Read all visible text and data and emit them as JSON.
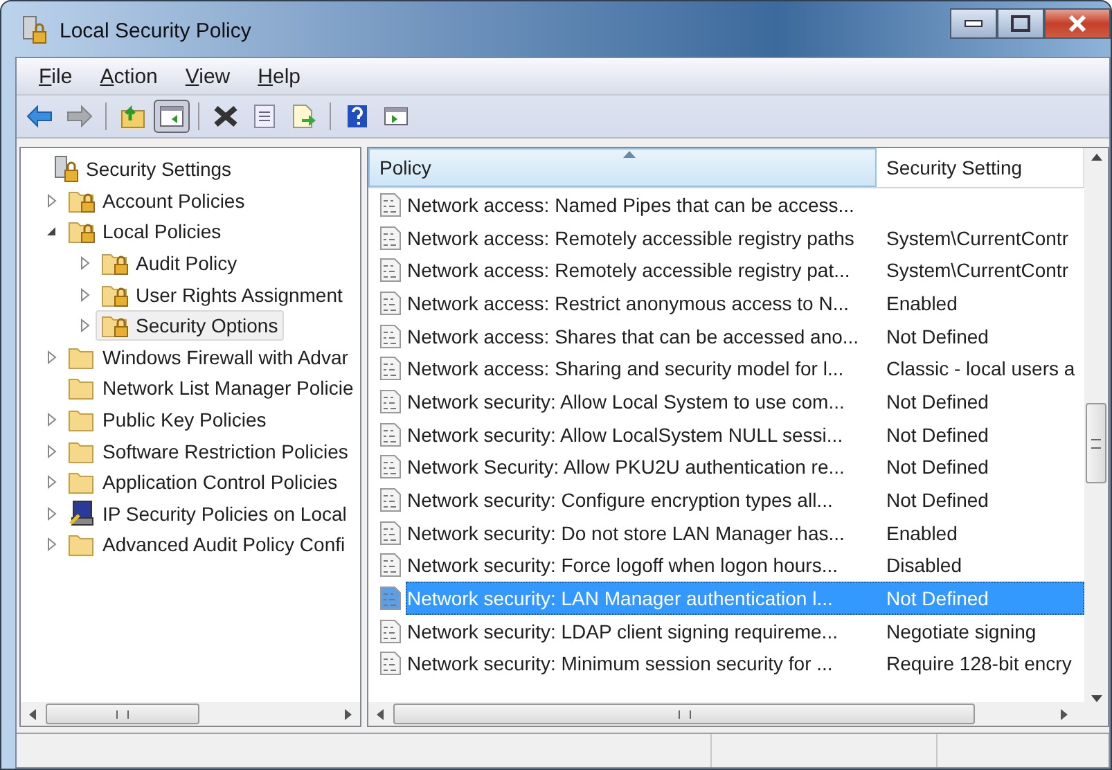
{
  "window": {
    "title": "Local Security Policy"
  },
  "menu": [
    "File",
    "Action",
    "View",
    "Help"
  ],
  "toolbar": [
    {
      "kind": "back",
      "disabled": false,
      "pressed": false
    },
    {
      "kind": "forward",
      "disabled": true,
      "pressed": false
    },
    {
      "kind": "sep"
    },
    {
      "kind": "up",
      "disabled": false,
      "pressed": false
    },
    {
      "kind": "tree",
      "disabled": false,
      "pressed": true
    },
    {
      "kind": "sep"
    },
    {
      "kind": "delete",
      "disabled": false,
      "pressed": false
    },
    {
      "kind": "properties",
      "disabled": false,
      "pressed": false
    },
    {
      "kind": "export",
      "disabled": false,
      "pressed": false
    },
    {
      "kind": "sep"
    },
    {
      "kind": "help",
      "disabled": false,
      "pressed": false
    },
    {
      "kind": "actionpane",
      "disabled": false,
      "pressed": false
    }
  ],
  "tree": [
    {
      "label": "Security Settings",
      "kind": "root",
      "selected": false,
      "children": [
        {
          "label": "Account Policies",
          "kind": "locked",
          "selected": false,
          "expanded": false
        },
        {
          "label": "Local Policies",
          "kind": "locked",
          "selected": false,
          "expanded": true,
          "children": [
            {
              "label": "Audit Policy",
              "kind": "locked",
              "selected": false,
              "expanded": false
            },
            {
              "label": "User Rights Assignment",
              "kind": "locked",
              "selected": false,
              "expanded": false
            },
            {
              "label": "Security Options",
              "kind": "locked",
              "selected": true,
              "expanded": false
            }
          ]
        },
        {
          "label": "Windows Firewall with Advar",
          "kind": "folder",
          "selected": false,
          "expanded": false
        },
        {
          "label": "Network List Manager Policie",
          "kind": "folder",
          "selected": false
        },
        {
          "label": "Public Key Policies",
          "kind": "folder",
          "selected": false,
          "expanded": false
        },
        {
          "label": "Software Restriction Policies",
          "kind": "folder",
          "selected": false,
          "expanded": false
        },
        {
          "label": "Application Control Policies",
          "kind": "folder",
          "selected": false,
          "expanded": false
        },
        {
          "label": "IP Security Policies on Local",
          "kind": "computer",
          "selected": false,
          "expanded": false
        },
        {
          "label": "Advanced Audit Policy Confi",
          "kind": "folder",
          "selected": false,
          "expanded": false
        }
      ]
    }
  ],
  "table": {
    "columns": [
      {
        "label": "Policy",
        "sorted": true
      },
      {
        "label": "Security Setting",
        "sorted": false
      }
    ],
    "rows": [
      {
        "policy": "Network access: Named Pipes that can be access...",
        "setting": "",
        "selected": false
      },
      {
        "policy": "Network access: Remotely accessible registry paths",
        "setting": "System\\CurrentContr",
        "selected": false
      },
      {
        "policy": "Network access: Remotely accessible registry pat...",
        "setting": "System\\CurrentContr",
        "selected": false
      },
      {
        "policy": "Network access: Restrict anonymous access to N...",
        "setting": "Enabled",
        "selected": false
      },
      {
        "policy": "Network access: Shares that can be accessed ano...",
        "setting": "Not Defined",
        "selected": false
      },
      {
        "policy": "Network access: Sharing and security model for l...",
        "setting": "Classic - local users a",
        "selected": false
      },
      {
        "policy": "Network security: Allow Local System to use com...",
        "setting": "Not Defined",
        "selected": false
      },
      {
        "policy": "Network security: Allow LocalSystem NULL sessi...",
        "setting": "Not Defined",
        "selected": false
      },
      {
        "policy": "Network Security: Allow PKU2U authentication re...",
        "setting": "Not Defined",
        "selected": false
      },
      {
        "policy": "Network security: Configure encryption types all...",
        "setting": "Not Defined",
        "selected": false
      },
      {
        "policy": "Network security: Do not store LAN Manager has...",
        "setting": "Enabled",
        "selected": false
      },
      {
        "policy": "Network security: Force logoff when logon hours...",
        "setting": "Disabled",
        "selected": false
      },
      {
        "policy": "Network security: LAN Manager authentication l...",
        "setting": "Not Defined",
        "selected": true
      },
      {
        "policy": "Network security: LDAP client signing requireme...",
        "setting": "Negotiate signing",
        "selected": false
      },
      {
        "policy": "Network security: Minimum session security for ...",
        "setting": "Require 128-bit encry",
        "selected": false
      }
    ]
  }
}
